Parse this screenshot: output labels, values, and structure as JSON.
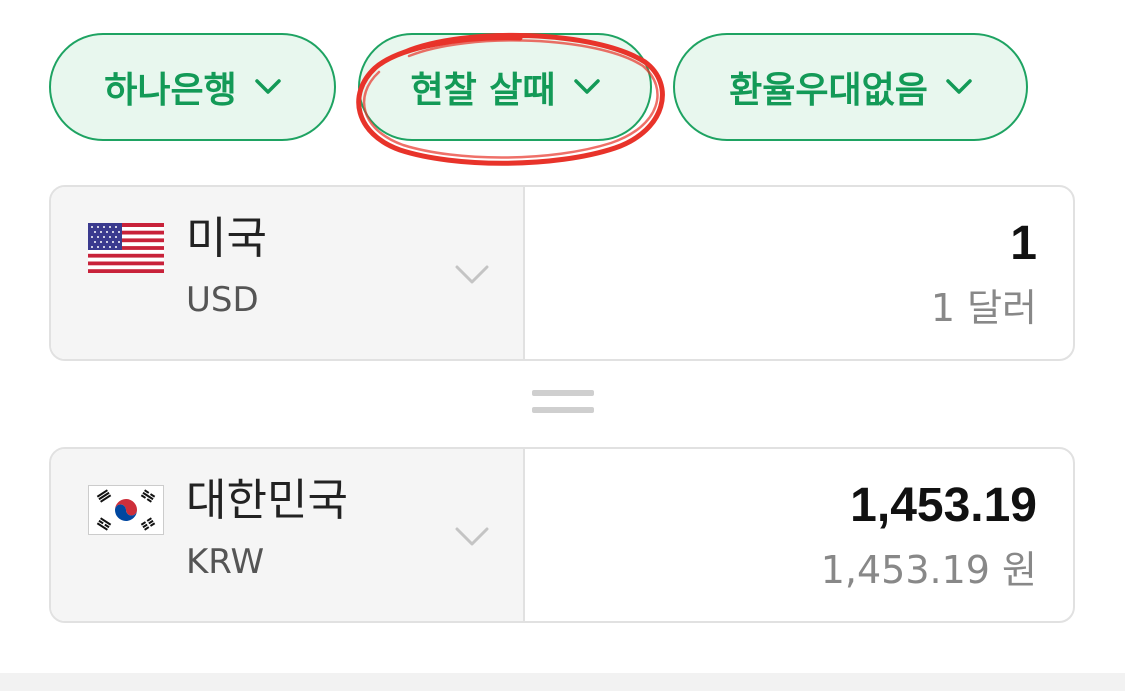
{
  "filters": {
    "bank": "하나은행",
    "cash_type": "현찰 살때",
    "preference": "환율우대없음"
  },
  "from": {
    "country": "미국",
    "code": "USD",
    "amount": "1",
    "amount_text": "1 달러",
    "flag_icon": "us-flag-icon"
  },
  "to": {
    "country": "대한민국",
    "code": "KRW",
    "amount": "1,453.19",
    "amount_text": "1,453.19 원",
    "flag_icon": "kr-flag-icon"
  },
  "colors": {
    "accent": "#139a57",
    "pill_bg": "#e8f7ee",
    "annotation": "#e8332a"
  }
}
